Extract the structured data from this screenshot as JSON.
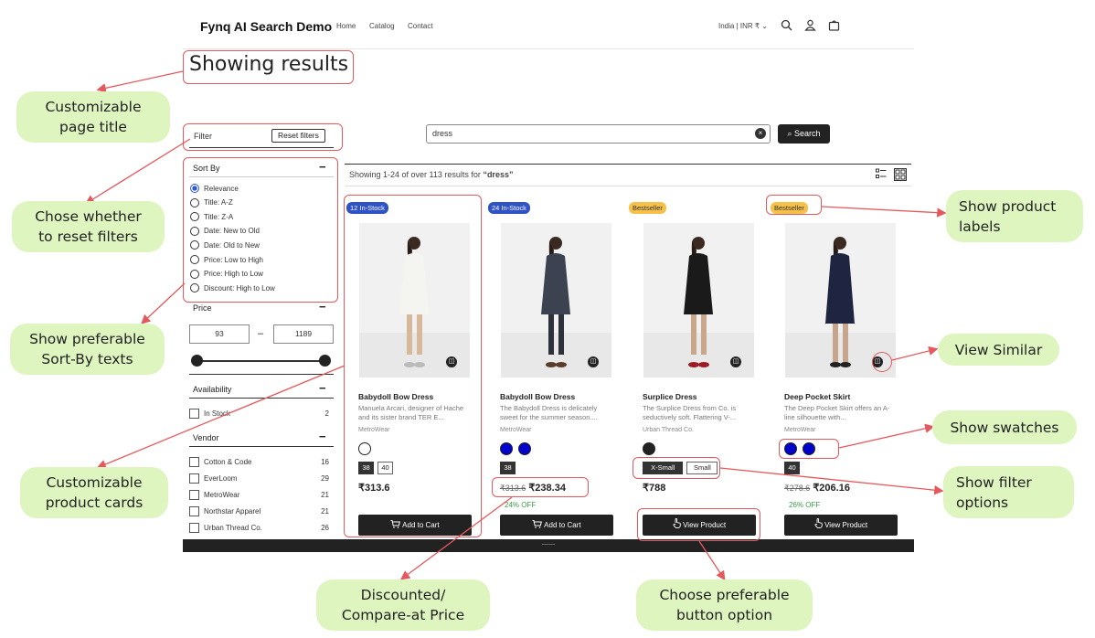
{
  "header": {
    "title": "Fynq AI Search Demo",
    "nav": [
      "Home",
      "Catalog",
      "Contact"
    ],
    "locale": "India | INR ₹",
    "icons": [
      "chevron-down-icon",
      "search-icon",
      "user-icon",
      "cart-icon"
    ]
  },
  "page_title": "Showing results",
  "filter": {
    "label": "Filter",
    "reset_label": "Reset filters",
    "sort_by": {
      "label": "Sort By",
      "options": [
        "Relevance",
        "Title: A-Z",
        "Title: Z-A",
        "Date: New to Old",
        "Date: Old to New",
        "Price: Low to High",
        "Price: High to Low",
        "Discount: High to Low"
      ],
      "selected": "Relevance"
    },
    "price": {
      "label": "Price",
      "min": "93",
      "max": "1189",
      "separator": "–"
    },
    "availability": {
      "label": "Availability",
      "items": [
        {
          "label": "In Stock",
          "count": "2"
        }
      ]
    },
    "vendor": {
      "label": "Vendor",
      "items": [
        {
          "label": "Cotton & Code",
          "count": "16"
        },
        {
          "label": "EverLoom",
          "count": "29"
        },
        {
          "label": "MetroWear",
          "count": "21"
        },
        {
          "label": "Northstar Apparel",
          "count": "21"
        },
        {
          "label": "Urban Thread Co.",
          "count": "26"
        }
      ]
    }
  },
  "search": {
    "value": "dress",
    "button_label": "Search"
  },
  "results": {
    "prefix": "Showing 1-24 of over 113 results for",
    "query": "“dress”"
  },
  "products": [
    {
      "badge": "12 In-Stock",
      "badge_color": "#2f52c4",
      "name": "Babydoll Bow Dress",
      "desc": "Manuela Arcari, designer of Hache and its sister brand TER E...",
      "vendor": "MetroWear",
      "swatches": [
        "#ffffff"
      ],
      "sizes": [
        "38",
        "40"
      ],
      "price": "₹313.6",
      "compare": "",
      "off": "",
      "button": "Add to Cart",
      "button_icon": "cart-icon"
    },
    {
      "badge": "24 In-Stock",
      "badge_color": "#2f52c4",
      "name": "Babydoll Bow Dress",
      "desc": "The Babydoll Dress is delicately sweet for the summer season....",
      "vendor": "MetroWear",
      "swatches": [
        "#0000cc",
        "#0000cc"
      ],
      "sizes": [
        "38"
      ],
      "price": "₹238.34",
      "compare": "₹313.6",
      "off": "24% OFF",
      "button": "Add to Cart",
      "button_icon": "cart-icon"
    },
    {
      "badge": "Bestseller",
      "badge_color": "#f6c14a",
      "name": "Surplice Dress",
      "desc": "The Surplice Dress from Co. is seductively soft. Flattering V-...",
      "vendor": "Urban Thread Co.",
      "swatches": [
        "#222222"
      ],
      "sizes": [
        "X-Small",
        "Small"
      ],
      "price": "₹788",
      "compare": "",
      "off": "",
      "button": "View Product",
      "button_icon": "hand-pointer-icon"
    },
    {
      "badge": "Bestseller",
      "badge_color": "#f6c14a",
      "name": "Deep Pocket Skirt",
      "desc": "The Deep Pocket Skirt offers an A-line silhouette with...",
      "vendor": "MetroWear",
      "swatches": [
        "#0000cc",
        "#0000cc"
      ],
      "sizes": [
        "40"
      ],
      "price": "₹206.16",
      "compare": "₹278.6",
      "off": "26% OFF",
      "button": "View Product",
      "button_icon": "hand-pointer-icon"
    }
  ],
  "annotations": {
    "page_title": "Customizable\npage title",
    "reset": "Chose whether\nto reset filters",
    "sortby": "Show preferable\nSort-By texts",
    "cards": "Customizable\nproduct cards",
    "discount": "Discounted/\nCompare-at Price",
    "button": "Choose preferable\nbutton option",
    "labels": "Show product\nlabels",
    "similar": "View Similar",
    "swatches": "Show swatches",
    "filter_options": "Show filter\noptions"
  },
  "colors": {
    "annotation_red": "#e4595d",
    "annotation_bg": "#dff5c0",
    "accent_blue": "#2d58d6",
    "discount_green": "#3aa04a"
  }
}
